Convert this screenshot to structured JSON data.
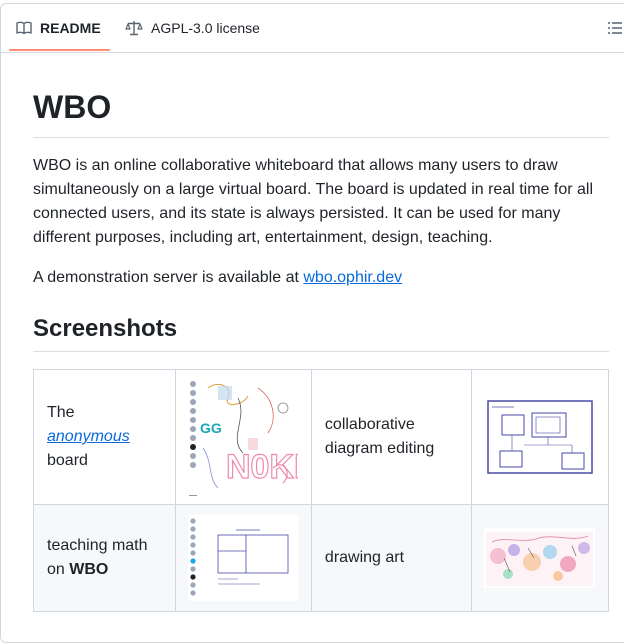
{
  "tabs": {
    "readme_label": "README",
    "license_label": "AGPL-3.0 license",
    "readme_icon": "book-icon",
    "license_icon": "law-icon",
    "toc_icon": "list-unordered-icon"
  },
  "readme": {
    "title": "WBO",
    "intro": "WBO is an online collaborative whiteboard that allows many users to draw simultaneously on a large virtual board. The board is updated in real time for all connected users, and its state is always persisted. It can be used for many different purposes, including art, entertainment, design, teaching.",
    "demo_prefix": "A demonstration server is available at ",
    "demo_link": "wbo.ophir.dev",
    "screenshots_heading": "Screenshots",
    "table": {
      "r1c1_pre": "The",
      "r1c1_link": "anonymous",
      "r1c1_post": "board",
      "r1c3": "collaborative diagram editing",
      "r2c1_pre": "teaching math on",
      "r2c1_bold": "WBO",
      "r2c3": "drawing art"
    }
  },
  "colors": {
    "link": "#0969da",
    "tab_underline": "#fd8c73",
    "border": "#d0d7de"
  }
}
